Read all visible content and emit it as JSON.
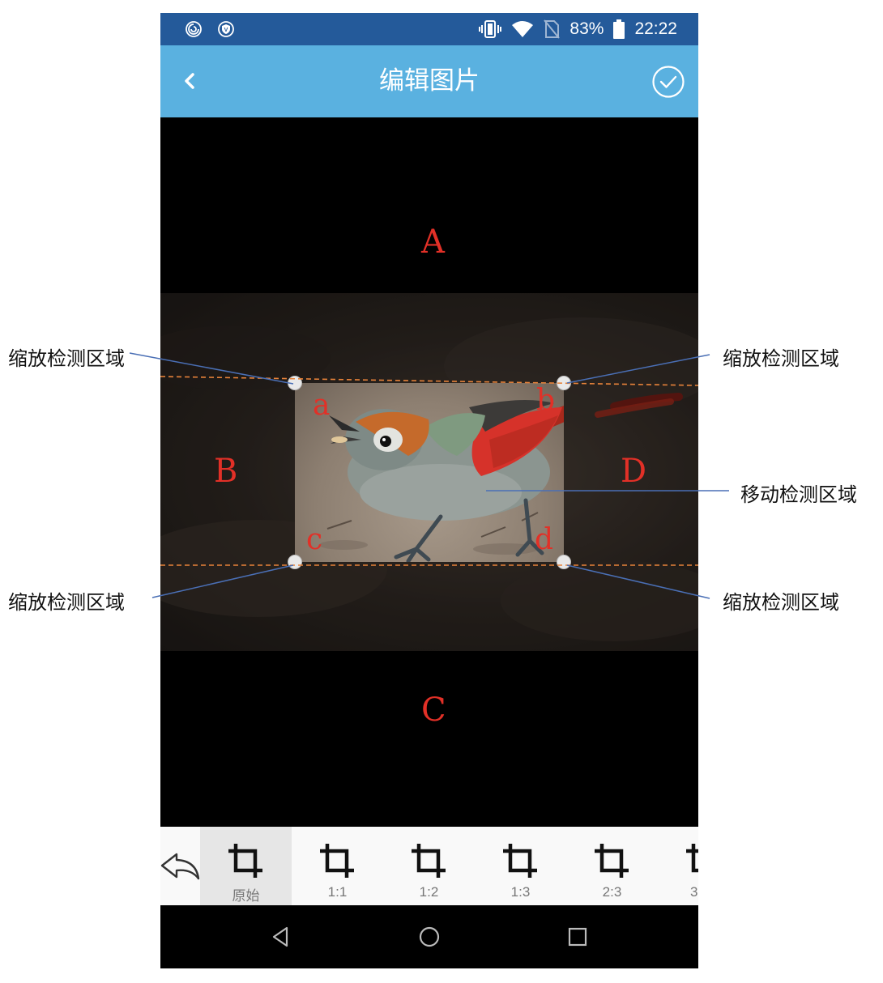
{
  "status_bar": {
    "battery": "83%",
    "time": "22:22",
    "background": "#245a9a"
  },
  "app_bar": {
    "title": "编辑图片",
    "back_icon": "chevron-left-icon",
    "confirm_icon": "check-circle-icon",
    "background": "#5ab1e0"
  },
  "editor": {
    "zones": {
      "top": "A",
      "left": "B",
      "bottom": "C",
      "right": "D"
    },
    "corners": {
      "top_left": "a",
      "top_right": "b",
      "bottom_left": "c",
      "bottom_right": "d"
    },
    "annotation_color": "#e23027"
  },
  "annotations": {
    "top_left": "缩放检测区域",
    "top_right": "缩放检测区域",
    "move": "移动检测区域",
    "bottom_left": "缩放检测区域",
    "bottom_right": "缩放检测区域"
  },
  "toolbar": {
    "undo_icon": "undo-icon",
    "crop_icon": "crop-icon",
    "ratios": [
      {
        "label": "原始",
        "active": true
      },
      {
        "label": "1:1",
        "active": false
      },
      {
        "label": "1:2",
        "active": false
      },
      {
        "label": "1:3",
        "active": false
      },
      {
        "label": "2:3",
        "active": false
      },
      {
        "label": "3",
        "active": false
      }
    ]
  },
  "nav_bar": {
    "back_icon": "nav-back-icon",
    "home_icon": "nav-home-icon",
    "recents_icon": "nav-recents-icon"
  }
}
